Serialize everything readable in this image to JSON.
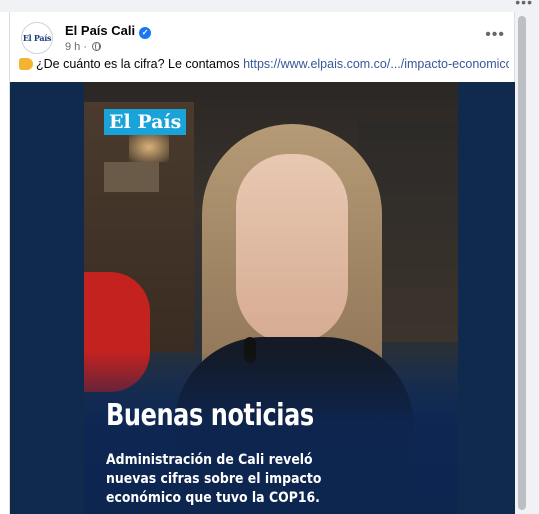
{
  "post": {
    "page_name": "El País Cali",
    "avatar_text": "El País",
    "verified_symbol": "✓",
    "time_ago": "9 h",
    "separator": "·",
    "menu_glyph": "•••",
    "caption": {
      "emoji": "pointing-hand-icon",
      "text": "¿De cuánto es la cifra? Le contamos ",
      "link": "https://www.elpais.com.co/.../impacto-economico-de-la..."
    }
  },
  "media": {
    "logo": "El País",
    "headline": "Buenas noticias",
    "subtitle_lines": [
      "Administración de Cali reveló",
      "nuevas cifras sobre el impacto",
      "económico que tuvo la COP16."
    ]
  },
  "top_more_glyph": "•••",
  "colors": {
    "link": "#385898",
    "verified": "#1877f2",
    "media_bg": "#0f2a4d",
    "logo_bg": "#1aa3d9"
  }
}
